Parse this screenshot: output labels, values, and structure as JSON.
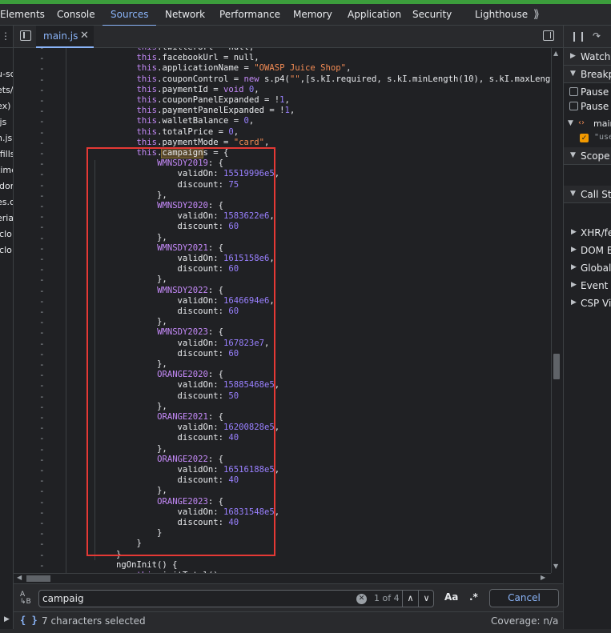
{
  "tabs": [
    "Elements",
    "Console",
    "Sources",
    "Network",
    "Performance",
    "Memory",
    "Application",
    "Security",
    "Lighthouse"
  ],
  "active_tab": "Sources",
  "navigator_items": [
    "u-sc",
    "ets/",
    "ex)",
    ".js",
    "n.js",
    "/fills",
    "time",
    "idor",
    "es.c",
    "eria",
    "iclo",
    "iclo"
  ],
  "editor": {
    "file_name": "main.js",
    "code": [
      [
        [
          "",
          "            "
        ],
        [
          "kw",
          "this"
        ],
        [
          "",
          ".twitterUrl = null,"
        ]
      ],
      [
        [
          "",
          "            "
        ],
        [
          "kw",
          "this"
        ],
        [
          "",
          ".facebookUrl = null,"
        ]
      ],
      [
        [
          "",
          "            "
        ],
        [
          "kw",
          "this"
        ],
        [
          "",
          ".applicationName = "
        ],
        [
          "str",
          "\"OWASP Juice Shop\""
        ],
        [
          "",
          ","
        ]
      ],
      [
        [
          "",
          "            "
        ],
        [
          "kw",
          "this"
        ],
        [
          "",
          ".couponControl = "
        ],
        [
          "kw",
          "new"
        ],
        [
          "",
          " s.p4("
        ],
        [
          "str",
          "\"\""
        ],
        [
          "",
          ",[s.kI.required, s.kI.minLength(10), s.kI.maxLength(10"
        ]
      ],
      [
        [
          "",
          "            "
        ],
        [
          "kw",
          "this"
        ],
        [
          "",
          ".paymentId = "
        ],
        [
          "kw",
          "void"
        ],
        [
          "",
          " "
        ],
        [
          "num",
          "0"
        ],
        [
          "",
          ","
        ]
      ],
      [
        [
          "",
          "            "
        ],
        [
          "kw",
          "this"
        ],
        [
          "",
          ".couponPanelExpanded = !"
        ],
        [
          "num",
          "1"
        ],
        [
          "",
          ","
        ]
      ],
      [
        [
          "",
          "            "
        ],
        [
          "kw",
          "this"
        ],
        [
          "",
          ".paymentPanelExpanded = !"
        ],
        [
          "num",
          "1"
        ],
        [
          "",
          ","
        ]
      ],
      [
        [
          "",
          "            "
        ],
        [
          "kw",
          "this"
        ],
        [
          "",
          ".walletBalance = "
        ],
        [
          "num",
          "0"
        ],
        [
          "",
          ","
        ]
      ],
      [
        [
          "",
          "            "
        ],
        [
          "kw",
          "this"
        ],
        [
          "",
          ".totalPrice = "
        ],
        [
          "num",
          "0"
        ],
        [
          "",
          ","
        ]
      ],
      [
        [
          "",
          "            "
        ],
        [
          "kw",
          "this"
        ],
        [
          "",
          ".paymentMode = "
        ],
        [
          "str",
          "\"card\""
        ],
        [
          "",
          ","
        ]
      ],
      [
        [
          "",
          "            "
        ],
        [
          "kw",
          "this"
        ],
        [
          "",
          "."
        ],
        [
          "hl",
          "campaign"
        ],
        [
          "",
          "s = {"
        ]
      ],
      [
        [
          "",
          "                "
        ],
        [
          "key",
          "WMNSDY2019"
        ],
        [
          "",
          ": {"
        ]
      ],
      [
        [
          "",
          "                    validOn: "
        ],
        [
          "num",
          "15519996e5"
        ],
        [
          "",
          ","
        ]
      ],
      [
        [
          "",
          "                    discount: "
        ],
        [
          "num",
          "75"
        ]
      ],
      [
        [
          "",
          "                },"
        ]
      ],
      [
        [
          "",
          "                "
        ],
        [
          "key",
          "WMNSDY2020"
        ],
        [
          "",
          ": {"
        ]
      ],
      [
        [
          "",
          "                    validOn: "
        ],
        [
          "num",
          "1583622e6"
        ],
        [
          "",
          ","
        ]
      ],
      [
        [
          "",
          "                    discount: "
        ],
        [
          "num",
          "60"
        ]
      ],
      [
        [
          "",
          "                },"
        ]
      ],
      [
        [
          "",
          "                "
        ],
        [
          "key",
          "WMNSDY2021"
        ],
        [
          "",
          ": {"
        ]
      ],
      [
        [
          "",
          "                    validOn: "
        ],
        [
          "num",
          "1615158e6"
        ],
        [
          "",
          ","
        ]
      ],
      [
        [
          "",
          "                    discount: "
        ],
        [
          "num",
          "60"
        ]
      ],
      [
        [
          "",
          "                },"
        ]
      ],
      [
        [
          "",
          "                "
        ],
        [
          "key",
          "WMNSDY2022"
        ],
        [
          "",
          ": {"
        ]
      ],
      [
        [
          "",
          "                    validOn: "
        ],
        [
          "num",
          "1646694e6"
        ],
        [
          "",
          ","
        ]
      ],
      [
        [
          "",
          "                    discount: "
        ],
        [
          "num",
          "60"
        ]
      ],
      [
        [
          "",
          "                },"
        ]
      ],
      [
        [
          "",
          "                "
        ],
        [
          "key",
          "WMNSDY2023"
        ],
        [
          "",
          ": {"
        ]
      ],
      [
        [
          "",
          "                    validOn: "
        ],
        [
          "num",
          "167823e7"
        ],
        [
          "",
          ","
        ]
      ],
      [
        [
          "",
          "                    discount: "
        ],
        [
          "num",
          "60"
        ]
      ],
      [
        [
          "",
          "                },"
        ]
      ],
      [
        [
          "",
          "                "
        ],
        [
          "key",
          "ORANGE2020"
        ],
        [
          "",
          ": {"
        ]
      ],
      [
        [
          "",
          "                    validOn: "
        ],
        [
          "num",
          "15885468e5"
        ],
        [
          "",
          ","
        ]
      ],
      [
        [
          "",
          "                    discount: "
        ],
        [
          "num",
          "50"
        ]
      ],
      [
        [
          "",
          "                },"
        ]
      ],
      [
        [
          "",
          "                "
        ],
        [
          "key",
          "ORANGE2021"
        ],
        [
          "",
          ": {"
        ]
      ],
      [
        [
          "",
          "                    validOn: "
        ],
        [
          "num",
          "16200828e5"
        ],
        [
          "",
          ","
        ]
      ],
      [
        [
          "",
          "                    discount: "
        ],
        [
          "num",
          "40"
        ]
      ],
      [
        [
          "",
          "                },"
        ]
      ],
      [
        [
          "",
          "                "
        ],
        [
          "key",
          "ORANGE2022"
        ],
        [
          "",
          ": {"
        ]
      ],
      [
        [
          "",
          "                    validOn: "
        ],
        [
          "num",
          "16516188e5"
        ],
        [
          "",
          ","
        ]
      ],
      [
        [
          "",
          "                    discount: "
        ],
        [
          "num",
          "40"
        ]
      ],
      [
        [
          "",
          "                },"
        ]
      ],
      [
        [
          "",
          "                "
        ],
        [
          "key",
          "ORANGE2023"
        ],
        [
          "",
          ": {"
        ]
      ],
      [
        [
          "",
          "                    validOn: "
        ],
        [
          "num",
          "16831548e5"
        ],
        [
          "",
          ","
        ]
      ],
      [
        [
          "",
          "                    discount: "
        ],
        [
          "num",
          "40"
        ]
      ],
      [
        [
          "",
          "                }"
        ]
      ],
      [
        [
          "",
          "            }"
        ]
      ],
      [
        [
          "",
          "        }"
        ]
      ],
      [
        [
          "",
          "        ngOnInit() {"
        ]
      ],
      [
        [
          "",
          "            "
        ],
        [
          "kw",
          "this"
        ],
        [
          "",
          ".initTotal()"
        ]
      ]
    ]
  },
  "search": {
    "value": "campaig",
    "match_count": "1 of 4",
    "case_label": "Aa",
    "regex_label": ".*",
    "cancel_label": "Cancel"
  },
  "status": {
    "selection": "7 characters selected",
    "coverage": "Coverage: n/a"
  },
  "debugger": {
    "watch": "Watch",
    "breakpoints": "Breakpoints",
    "pause1": "Pause on uncaught exceptions",
    "pause2": "Pause on caught exceptions",
    "bp_file": "main.js",
    "bp_line": "\"use strict\"",
    "scope": "Scope",
    "call_stack": "Call Stack",
    "xhr": "XHR/fetch Breakpoints",
    "dom": "DOM Breakpoints",
    "global": "Global Listeners",
    "event": "Event Listener Breakpoints",
    "csp": "CSP Violation Breakpoints"
  },
  "colors": {
    "accent": "#8ab4f8",
    "annotation": "#e53935",
    "progress_strip": "#3c9d3c"
  }
}
